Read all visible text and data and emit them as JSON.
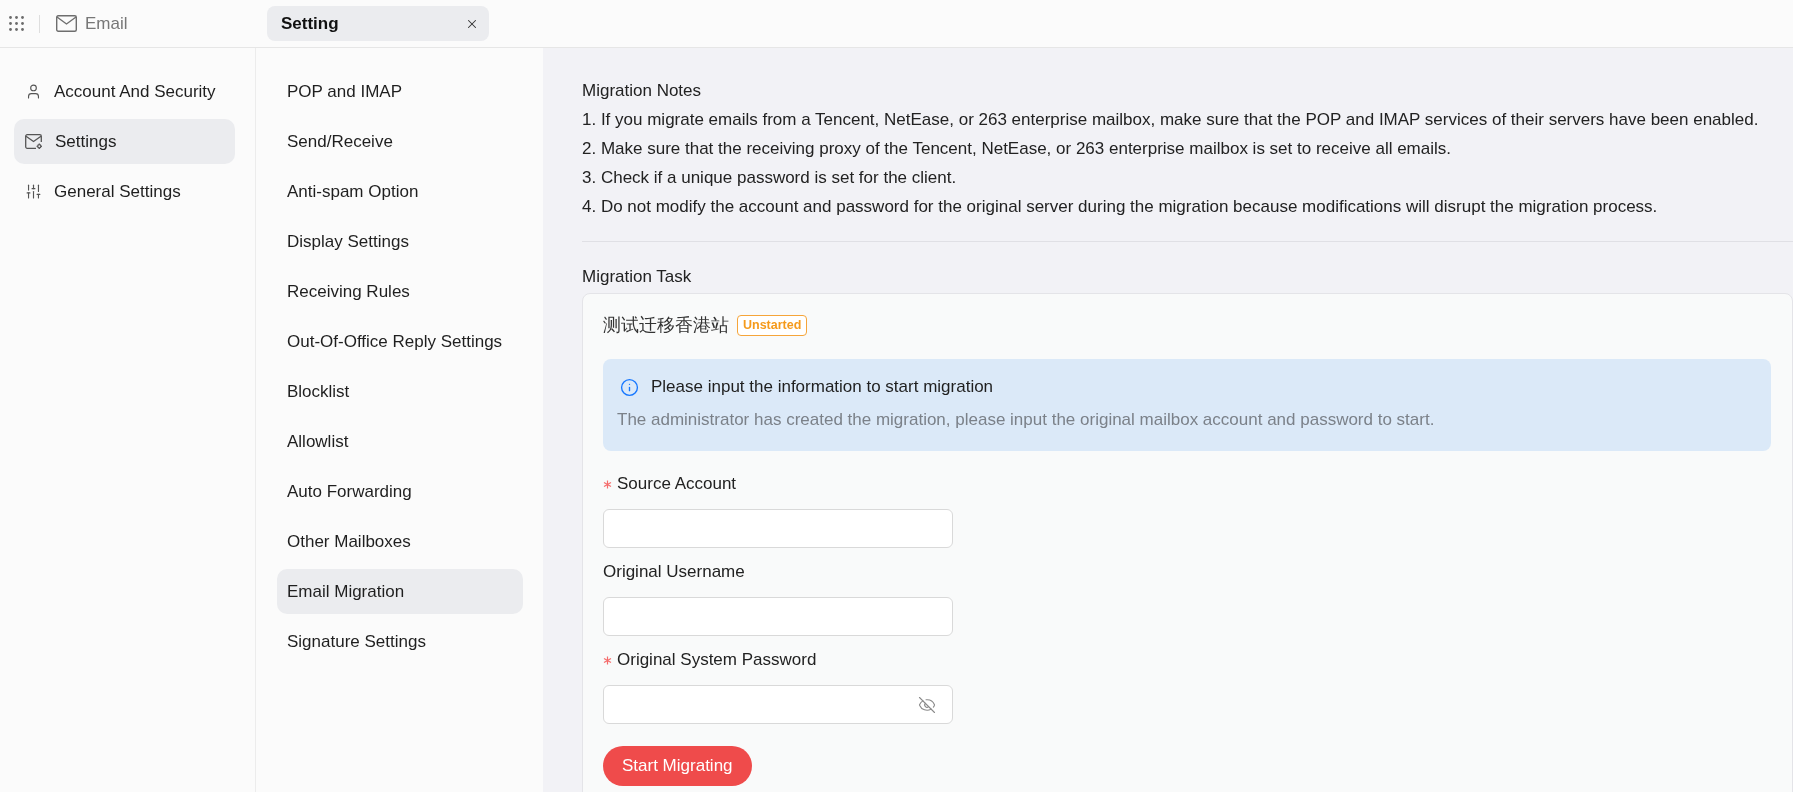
{
  "top_bar": {
    "app_title": "Email",
    "tabs": [
      {
        "label": "Setting",
        "selected": true
      }
    ]
  },
  "nav": [
    {
      "label": "Account And Security",
      "selected": false
    },
    {
      "label": "Settings",
      "selected": true
    },
    {
      "label": "General Settings",
      "selected": false
    }
  ],
  "settings_menu": [
    {
      "label": "POP and IMAP",
      "selected": false
    },
    {
      "label": "Send/Receive",
      "selected": false
    },
    {
      "label": "Anti-spam Option",
      "selected": false
    },
    {
      "label": "Display Settings",
      "selected": false
    },
    {
      "label": "Receiving Rules",
      "selected": false
    },
    {
      "label": "Out-Of-Office Reply Settings",
      "selected": false
    },
    {
      "label": "Blocklist",
      "selected": false
    },
    {
      "label": "Allowlist",
      "selected": false
    },
    {
      "label": "Auto Forwarding",
      "selected": false
    },
    {
      "label": "Other Mailboxes",
      "selected": false
    },
    {
      "label": "Email Migration",
      "selected": true
    },
    {
      "label": "Signature Settings",
      "selected": false
    }
  ],
  "migration_notes": {
    "title": "Migration Notes",
    "items": [
      "1. If you migrate emails from a Tencent, NetEase, or 263 enterprise mailbox, make sure that the POP and IMAP services of their servers have been enabled.",
      "2. Make sure that the receiving proxy of the Tencent, NetEase, or 263 enterprise mailbox is set to receive all emails.",
      "3. Check if a unique password is set for the client.",
      "4. Do not modify the account and password for the original server during the migration because modifications will disrupt the migration process."
    ]
  },
  "migration_task": {
    "title": "Migration Task",
    "task_name": "测试迁移香港站",
    "status": "Unstarted",
    "alert": {
      "title": "Please input the information to start migration",
      "description": "The administrator has created the migration, please input the original mailbox account and password to start."
    },
    "fields": [
      {
        "label": "Source Account",
        "required": true,
        "kind": "text"
      },
      {
        "label": "Original Username",
        "required": false,
        "kind": "text"
      },
      {
        "label": "Original System Password",
        "required": true,
        "kind": "password"
      }
    ],
    "submit_button": "Start Migrating"
  }
}
